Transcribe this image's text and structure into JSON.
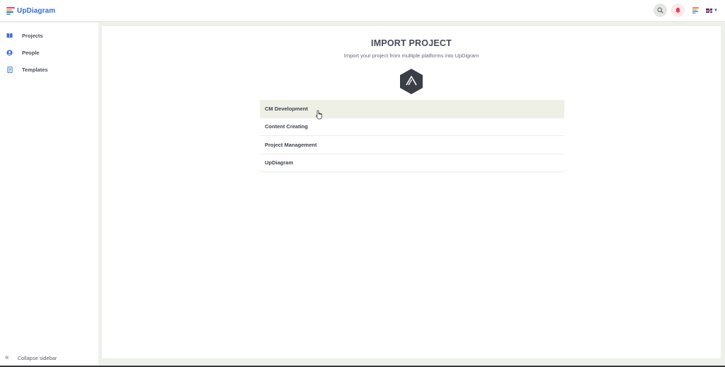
{
  "header": {
    "app_name": "UpDiagram",
    "brand_color": "#2f6fd6",
    "search_icon": "search-icon",
    "bell_icon": "bell-icon",
    "apps_icon": "apps-icon",
    "language_icon": "uk-flag-icon"
  },
  "sidebar": {
    "items": [
      {
        "label": "Projects",
        "icon": "book-icon"
      },
      {
        "label": "People",
        "icon": "user-icon"
      },
      {
        "label": "Templates",
        "icon": "document-icon"
      }
    ],
    "collapse_label": "Collapse sidebar"
  },
  "main": {
    "title": "IMPORT PROJECT",
    "subtitle": "Import your project from multiple platforms into UpDigram",
    "platform_icon": "asana-hexagon-icon",
    "projects": [
      {
        "label": "CM Development",
        "active": true
      },
      {
        "label": "Content Creating",
        "active": false
      },
      {
        "label": "Project Management",
        "active": false
      },
      {
        "label": "UpDiagram",
        "active": false
      }
    ]
  }
}
